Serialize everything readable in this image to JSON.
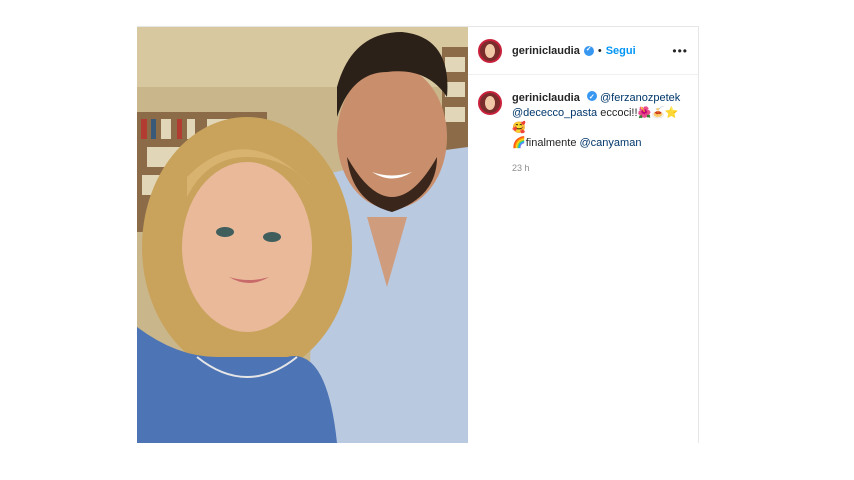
{
  "post": {
    "username": "geriniclaudia",
    "follow_label": "Segui",
    "separator": "•",
    "more_label": "•••",
    "caption": {
      "username": "geriniclaudia",
      "mention1": "@ferzanozpetek",
      "mention2": "@dececco_pasta",
      "text1": " eccoci!!",
      "emojis1": "🌺🍝⭐🥰",
      "emoji2": "🌈",
      "text2": "finalmente ",
      "mention3": "@canyaman"
    },
    "time": "23 h"
  },
  "colors": {
    "accent": "#0095f6",
    "verified": "#3897f0",
    "mention": "#00376b"
  }
}
